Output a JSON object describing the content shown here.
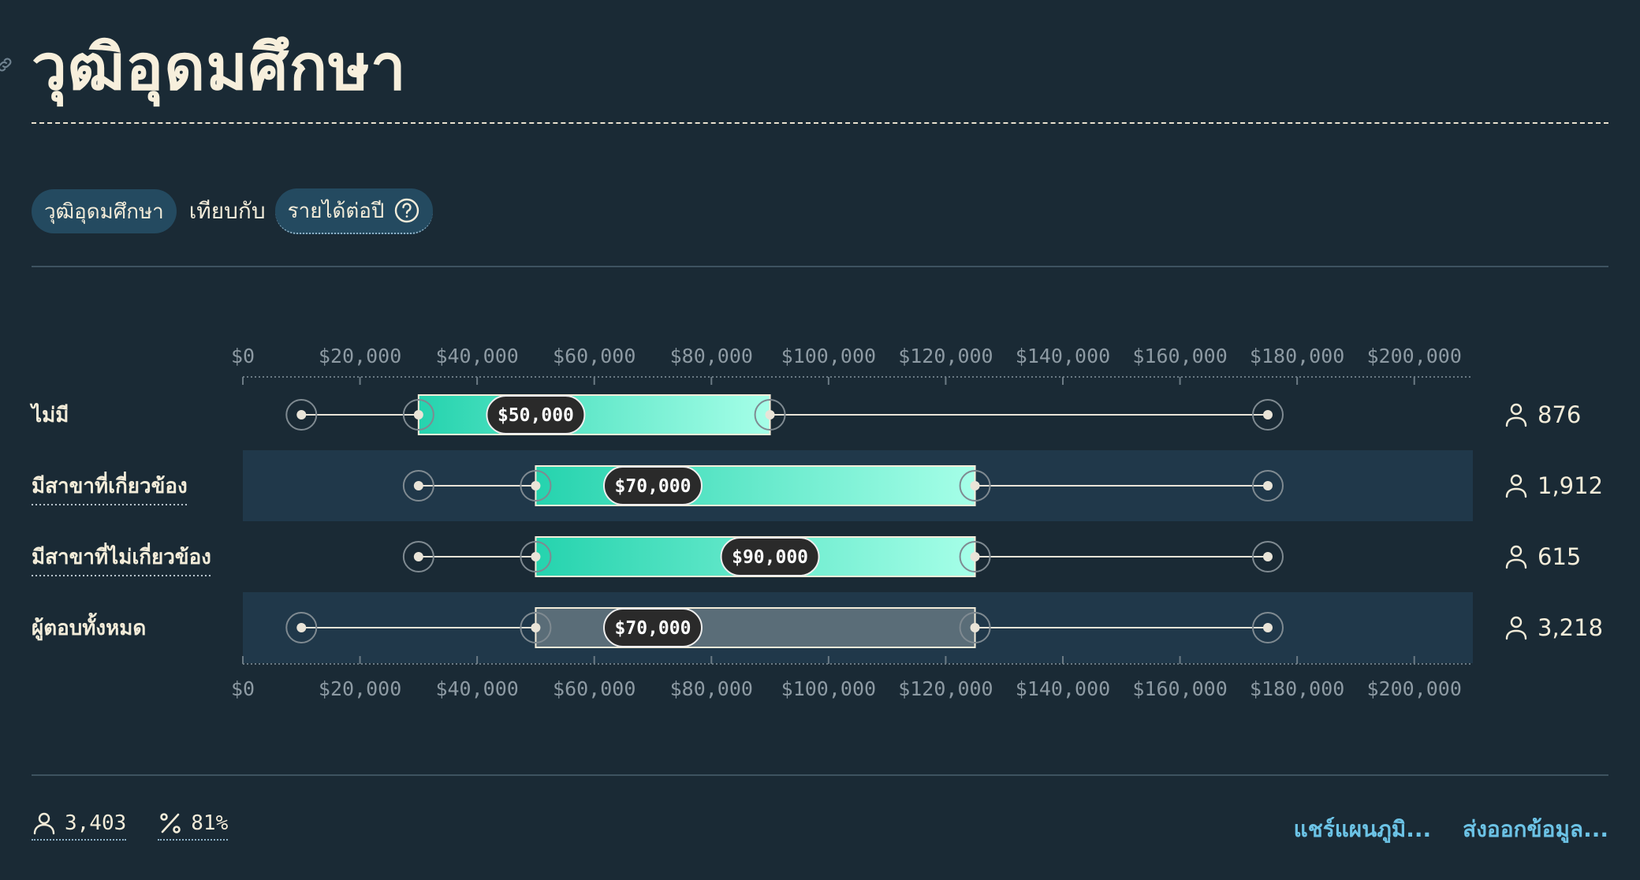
{
  "header": {
    "title": "วุฒิอุดมศึกษา"
  },
  "filters": {
    "dimension_label": "วุฒิอุดมศึกษา",
    "versus_label": "เทียบกับ",
    "metric_label": "รายได้ต่อปี"
  },
  "colors": {
    "background": "#1a2a35",
    "band": "#20384a",
    "bar_start": "#25d3ae",
    "bar_end": "#a6ffe8",
    "overall_bar": "#5a6d78",
    "text": "#f3ecd9",
    "axis_text": "#8d9aa3",
    "link": "#6cc3e6"
  },
  "chart_data": {
    "type": "box",
    "axis": {
      "min": 0,
      "max": 210000,
      "ticks": [
        0,
        20000,
        40000,
        60000,
        80000,
        100000,
        120000,
        140000,
        160000,
        180000,
        200000
      ],
      "tick_labels": [
        "$0",
        "$20,000",
        "$40,000",
        "$60,000",
        "$80,000",
        "$100,000",
        "$120,000",
        "$140,000",
        "$160,000",
        "$180,000",
        "$200,000"
      ]
    },
    "rows": [
      {
        "label": "ไม่มี",
        "min": 10000,
        "q1": 30000,
        "median": 50000,
        "q3": 90000,
        "max": 175000,
        "median_label": "$50,000",
        "count": "876",
        "underlined": false,
        "overall": false
      },
      {
        "label": "มีสาขาที่เกี่ยวข้อง",
        "min": 30000,
        "q1": 50000,
        "median": 70000,
        "q3": 125000,
        "max": 175000,
        "median_label": "$70,000",
        "count": "1,912",
        "underlined": true,
        "overall": false
      },
      {
        "label": "มีสาขาที่ไม่เกี่ยวข้อง",
        "min": 30000,
        "q1": 50000,
        "median": 90000,
        "q3": 125000,
        "max": 175000,
        "median_label": "$90,000",
        "count": "615",
        "underlined": true,
        "overall": false
      },
      {
        "label": "ผู้ตอบทั้งหมด",
        "min": 10000,
        "q1": 50000,
        "median": 70000,
        "q3": 125000,
        "max": 175000,
        "median_label": "$70,000",
        "count": "3,218",
        "underlined": false,
        "overall": true
      }
    ]
  },
  "footer": {
    "respondents": "3,403",
    "percent": "81%",
    "share_label": "แชร์แผนภูมิ...",
    "export_label": "ส่งออกข้อมูล..."
  }
}
